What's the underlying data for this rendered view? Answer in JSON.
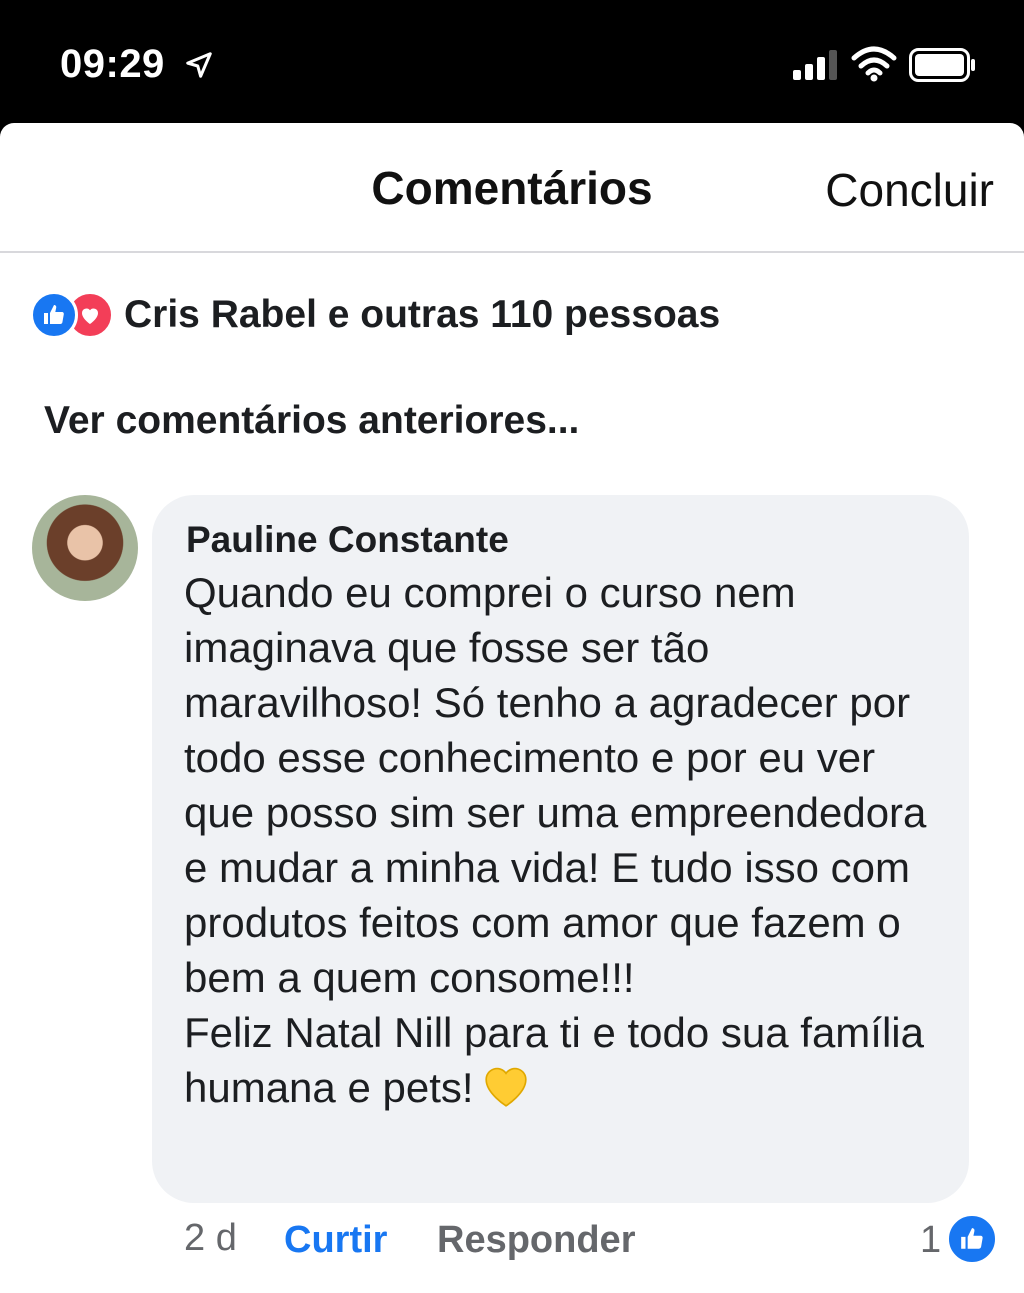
{
  "status_bar": {
    "time": "09:29"
  },
  "header": {
    "title": "Comentários",
    "done_label": "Concluir"
  },
  "reactions": {
    "summary": "Cris Rabel e outras 110 pessoas",
    "types": [
      "like",
      "love"
    ]
  },
  "view_previous": "Ver comentários anteriores...",
  "comment": {
    "author": "Pauline Constante",
    "text": "Quando eu comprei o curso nem imaginava que fosse ser tão maravilhoso! Só tenho a agradecer por todo esse conhecimento e por eu ver que posso sim ser uma empreendedora e mudar a minha vida! E tudo isso com produtos feitos com amor que fazem o bem a quem consome!!!\nFeliz Natal Nill para ti e todo sua família humana e pets!",
    "time_ago": "2 d",
    "like_label": "Curtir",
    "reply_label": "Responder",
    "like_count": "1"
  },
  "colors": {
    "accent": "#1877f2",
    "love": "#f33e58",
    "bubble": "#f0f2f5",
    "muted": "#65676b"
  }
}
